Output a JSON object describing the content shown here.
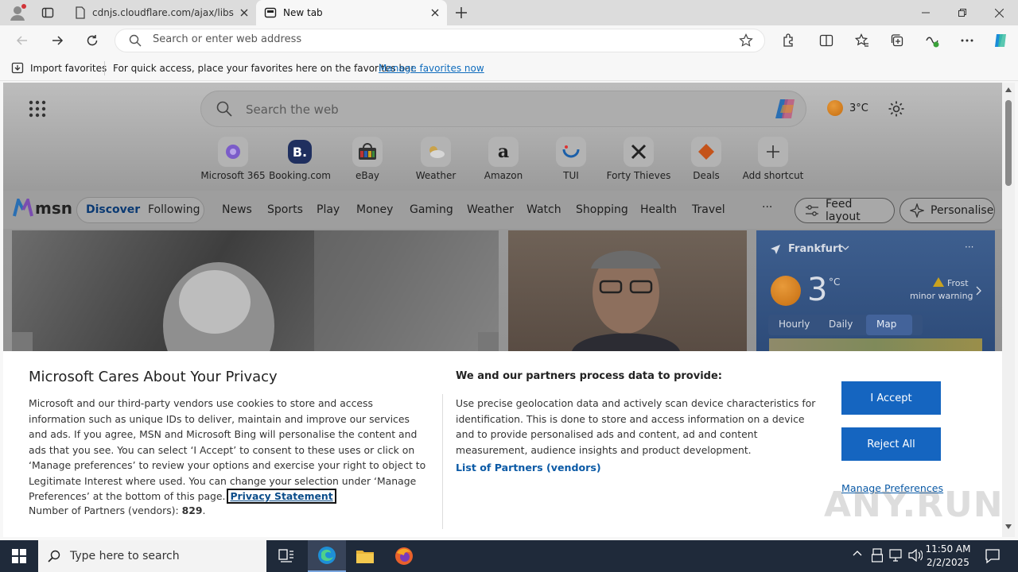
{
  "browser": {
    "tabs": [
      {
        "title": "cdnjs.cloudflare.com/ajax/libs/c"
      },
      {
        "title": "New tab"
      }
    ],
    "address_placeholder": "Search or enter web address",
    "favorites_bar": {
      "import_label": "Import favorites",
      "message": "For quick access, place your favorites here on the favorites bar.",
      "link": "Manage favorites now"
    }
  },
  "newtab": {
    "search_placeholder": "Search the web",
    "weather_temp": "3°C",
    "shortcuts": [
      {
        "label": "Microsoft 365",
        "icon": "microsoft-365-icon"
      },
      {
        "label": "Booking.com",
        "icon": "booking-icon"
      },
      {
        "label": "eBay",
        "icon": "ebay-icon"
      },
      {
        "label": "Weather",
        "icon": "weather-icon"
      },
      {
        "label": "Amazon",
        "icon": "amazon-icon"
      },
      {
        "label": "TUI",
        "icon": "tui-icon"
      },
      {
        "label": "Forty Thieves",
        "icon": "forty-thieves-icon"
      },
      {
        "label": "Deals",
        "icon": "deals-icon"
      },
      {
        "label": "Add shortcut",
        "icon": "plus-icon"
      }
    ],
    "msn": {
      "logo": "msn",
      "feed_tabs": [
        "Discover",
        "Following"
      ],
      "nav": [
        "News",
        "Sports",
        "Play",
        "Money",
        "Gaming",
        "Weather",
        "Watch",
        "Shopping",
        "Health",
        "Travel"
      ],
      "more": "···",
      "feed_layout": "Feed layout",
      "personalise": "Personalise"
    },
    "weather_card": {
      "city": "Frankfurt",
      "temp": "3",
      "unit": "°C",
      "alert": "Frost",
      "alert_sub": "minor warning",
      "tabs": [
        "Hourly",
        "Daily",
        "Map"
      ]
    }
  },
  "privacy": {
    "title": "Microsoft Cares About Your Privacy",
    "body": "Microsoft and our third-party vendors use cookies to store and access information such as unique IDs to deliver, maintain and improve our services and ads. If you agree, MSN and Microsoft Bing will personalise the content and ads that you see. You can select ‘I Accept’ to consent to these uses or click on ‘Manage preferences’ to review your options and exercise your right to object to Legitimate Interest where used.  You can change your selection under ‘Manage Preferences’ at the bottom of this page.",
    "privacy_link": "Privacy Statement",
    "partners_label": "Number of Partners (vendors):",
    "partners_count": "829",
    "purpose_heading": "We and our partners process data to provide:",
    "purpose_text": "Use precise geolocation data and actively scan device characteristics for identification. This is done to store and access information on a device and to provide personalised ads and content, ad and content measurement, audience insights and product development.",
    "vendors_link": "List of Partners (vendors)",
    "accept": "I Accept",
    "reject": "Reject All",
    "manage": "Manage Preferences"
  },
  "watermark": "ANY.RUN",
  "taskbar": {
    "search_placeholder": "Type here to search",
    "time": "11:50 AM",
    "date": "2/2/2025"
  }
}
